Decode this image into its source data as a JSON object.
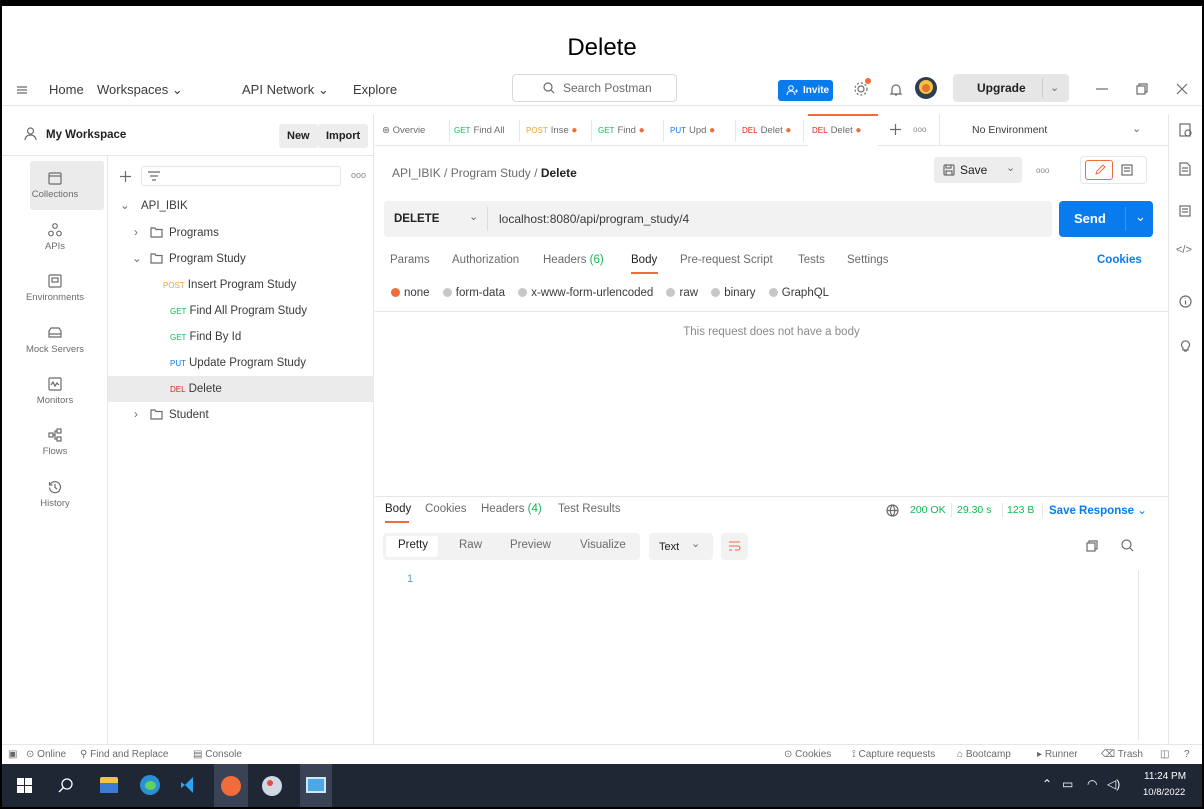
{
  "caption": "Delete",
  "nav": {
    "home": "Home",
    "workspaces": "Workspaces",
    "api_network": "API Network",
    "explore": "Explore",
    "search_placeholder": "Search Postman",
    "invite": "Invite",
    "upgrade": "Upgrade"
  },
  "workspace": {
    "name": "My Workspace",
    "new": "New",
    "import": "Import"
  },
  "rail": [
    {
      "label": "Collections",
      "icon": "collections-icon"
    },
    {
      "label": "APIs",
      "icon": "apis-icon"
    },
    {
      "label": "Environments",
      "icon": "environments-icon"
    },
    {
      "label": "Mock Servers",
      "icon": "mock-servers-icon"
    },
    {
      "label": "Monitors",
      "icon": "monitors-icon"
    },
    {
      "label": "Flows",
      "icon": "flows-icon"
    },
    {
      "label": "History",
      "icon": "history-icon"
    }
  ],
  "tree": {
    "root": "API_IBIK",
    "programs": "Programs",
    "program_study": "Program Study",
    "student": "Student",
    "requests": [
      {
        "method": "POST",
        "name": "Insert Program Study"
      },
      {
        "method": "GET",
        "name": "Find All Program Study"
      },
      {
        "method": "GET",
        "name": "Find By Id"
      },
      {
        "method": "PUT",
        "name": "Update Program Study"
      },
      {
        "method": "DEL",
        "name": "Delete"
      }
    ]
  },
  "tabs": [
    {
      "method": "",
      "label": "Overvie"
    },
    {
      "method": "GET",
      "label": "Find All"
    },
    {
      "method": "POST",
      "label": "Inse"
    },
    {
      "method": "GET",
      "label": "Find"
    },
    {
      "method": "PUT",
      "label": "Upd"
    },
    {
      "method": "DEL",
      "label": "Delet"
    },
    {
      "method": "DEL",
      "label": "Delet"
    }
  ],
  "environment": "No Environment",
  "breadcrumb": {
    "collection": "API_IBIK",
    "folder": "Program Study",
    "sep": "/",
    "request": "Delete"
  },
  "request": {
    "save": "Save",
    "method": "DELETE",
    "url": "localhost:8080/api/program_study/4",
    "send": "Send",
    "subtabs": {
      "params": "Params",
      "authorization": "Authorization",
      "headers": "Headers",
      "headers_count": "(6)",
      "body": "Body",
      "prerequest": "Pre-request Script",
      "tests": "Tests",
      "settings": "Settings",
      "cookies": "Cookies"
    },
    "body_types": [
      "none",
      "form-data",
      "x-www-form-urlencoded",
      "raw",
      "binary",
      "GraphQL"
    ],
    "no_body": "This request does not have a body"
  },
  "response": {
    "tabs": {
      "body": "Body",
      "cookies": "Cookies",
      "headers": "Headers",
      "headers_count": "(4)",
      "test_results": "Test Results"
    },
    "status": "200 OK",
    "time": "29.30 s",
    "size": "123 B",
    "save_response": "Save Response",
    "views": {
      "pretty": "Pretty",
      "raw": "Raw",
      "preview": "Preview",
      "visualize": "Visualize",
      "format": "Text"
    },
    "line_number": "1"
  },
  "statusbar": {
    "online": "Online",
    "find_replace": "Find and Replace",
    "console": "Console",
    "cookies": "Cookies",
    "capture": "Capture requests",
    "bootcamp": "Bootcamp",
    "runner": "Runner",
    "trash": "Trash"
  },
  "taskbar": {
    "time": "11:24 PM",
    "date": "10/8/2022"
  },
  "colors": {
    "accent": "#f26b3a",
    "blue": "#097bed",
    "get": "#0cbb52",
    "post": "#f2a22d",
    "put": "#097bed",
    "del": "#eb2013",
    "taskbar": "#1f2634"
  }
}
